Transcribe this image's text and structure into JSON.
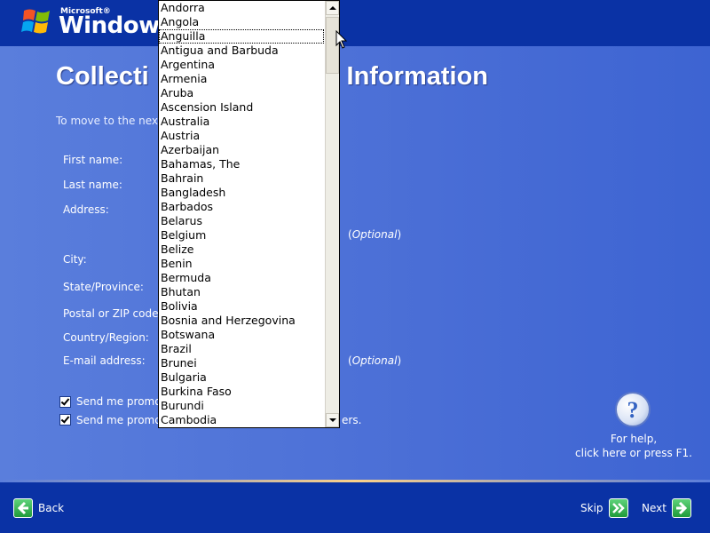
{
  "brand": {
    "microsoft": "Microsoft®",
    "windows": "Windows"
  },
  "header": {
    "title": "Collecting Registration Information",
    "instruction": "To move to the next box, press TAB. Fill in your information.",
    "title_visible_left": "Collecti",
    "title_visible_right": "n Information",
    "instruction_visible": "To move to the next b"
  },
  "form": {
    "first_name_label": "First name:",
    "last_name_label": "Last name:",
    "address_label": "Address:",
    "city_label": "City:",
    "state_label": "State/Province:",
    "postal_label": "Postal or ZIP code:",
    "country_label": "Country/Region:",
    "email_label": "E-mail address:",
    "optional_text": "Optional"
  },
  "checkboxes": [
    {
      "label_visible": "Send me promot",
      "suffix": "",
      "checked": true
    },
    {
      "label_visible": "Send me promot",
      "suffix": "ers.",
      "checked": true
    }
  ],
  "country_list": {
    "focused_index": 2,
    "items": [
      "Andorra",
      "Angola",
      "Anguilla",
      "Antigua and Barbuda",
      "Argentina",
      "Armenia",
      "Aruba",
      "Ascension Island",
      "Australia",
      "Austria",
      "Azerbaijan",
      "Bahamas, The",
      "Bahrain",
      "Bangladesh",
      "Barbados",
      "Belarus",
      "Belgium",
      "Belize",
      "Benin",
      "Bermuda",
      "Bhutan",
      "Bolivia",
      "Bosnia and Herzegovina",
      "Botswana",
      "Brazil",
      "Brunei",
      "Bulgaria",
      "Burkina Faso",
      "Burundi",
      "Cambodia"
    ]
  },
  "help": {
    "icon": "question-mark-icon",
    "line1": "For help,",
    "line2": "click here or press F1."
  },
  "nav": {
    "back": "Back",
    "skip": "Skip",
    "next": "Next"
  },
  "colors": {
    "band": "#0a32a5",
    "content": "#5a7edc",
    "accent_line": "#fbd18a",
    "arrow_green": "#2fb04c"
  }
}
